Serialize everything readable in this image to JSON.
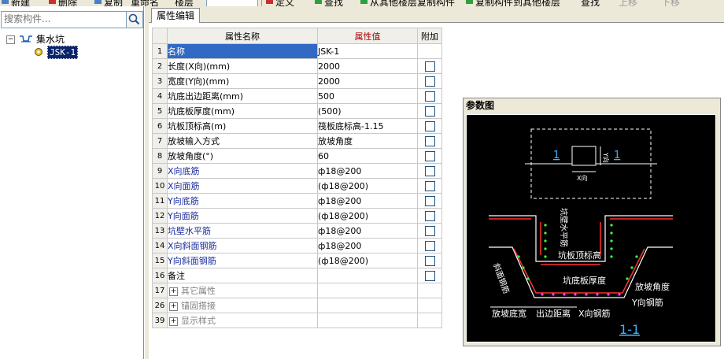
{
  "toolbar": {
    "items": [
      "新建",
      "删除",
      "复制",
      "重命名",
      "楼层",
      "定义",
      "从其他楼层复制构件",
      "复制构件到其他楼层",
      "查找",
      "上移",
      "下移"
    ]
  },
  "left": {
    "search_placeholder": "搜索构件...",
    "tree_root": "集水坑",
    "tree_child": "JSK-1"
  },
  "tab": "属性编辑",
  "table": {
    "headers": {
      "name": "属性名称",
      "value": "属性值",
      "add": "附加"
    },
    "rows": [
      {
        "num": "1",
        "name": "名称",
        "value": "JSK-1"
      },
      {
        "num": "2",
        "name": "长度(X向)(mm)",
        "value": "2000"
      },
      {
        "num": "3",
        "name": "宽度(Y向)(mm)",
        "value": "2000"
      },
      {
        "num": "4",
        "name": "坑底出边距离(mm)",
        "value": "500"
      },
      {
        "num": "5",
        "name": "坑底板厚度(mm)",
        "value": "(500)"
      },
      {
        "num": "6",
        "name": "坑板顶标高(m)",
        "value": "筏板底标高-1.15"
      },
      {
        "num": "7",
        "name": "放坡输入方式",
        "value": "放坡角度"
      },
      {
        "num": "8",
        "name": "放坡角度(°)",
        "value": "60"
      },
      {
        "num": "9",
        "name": "X向底筋",
        "value": "ф18@200"
      },
      {
        "num": "10",
        "name": "X向面筋",
        "value": "(ф18@200)"
      },
      {
        "num": "11",
        "name": "Y向底筋",
        "value": "ф18@200"
      },
      {
        "num": "12",
        "name": "Y向面筋",
        "value": "(ф18@200)"
      },
      {
        "num": "13",
        "name": "坑壁水平筋",
        "value": "ф18@200"
      },
      {
        "num": "14",
        "name": "X向斜面钢筋",
        "value": "ф18@200"
      },
      {
        "num": "15",
        "name": "Y向斜面钢筋",
        "value": "(ф18@200)"
      },
      {
        "num": "16",
        "name": "备注",
        "value": ""
      },
      {
        "num": "17",
        "name": "其它属性",
        "value": ""
      },
      {
        "num": "26",
        "name": "锚固搭接",
        "value": ""
      },
      {
        "num": "39",
        "name": "显示样式",
        "value": ""
      }
    ]
  },
  "diagram": {
    "title": "参数图",
    "label_1": "1",
    "label_x": "X向",
    "label_y": "Y向",
    "label_wall_rebar": "坑壁水平筋",
    "label_top_elev": "坑板顶标高",
    "label_slope_rebar": "斜面钢筋",
    "label_bottom_thick": "坑底板厚度",
    "label_slope_angle": "放坡角度",
    "label_y_rebar": "Y向钢筋",
    "label_x_rebar": "X向钢筋",
    "label_slope_width": "放坡底宽",
    "label_edge_dist": "出边距离",
    "label_section": "1-1"
  }
}
